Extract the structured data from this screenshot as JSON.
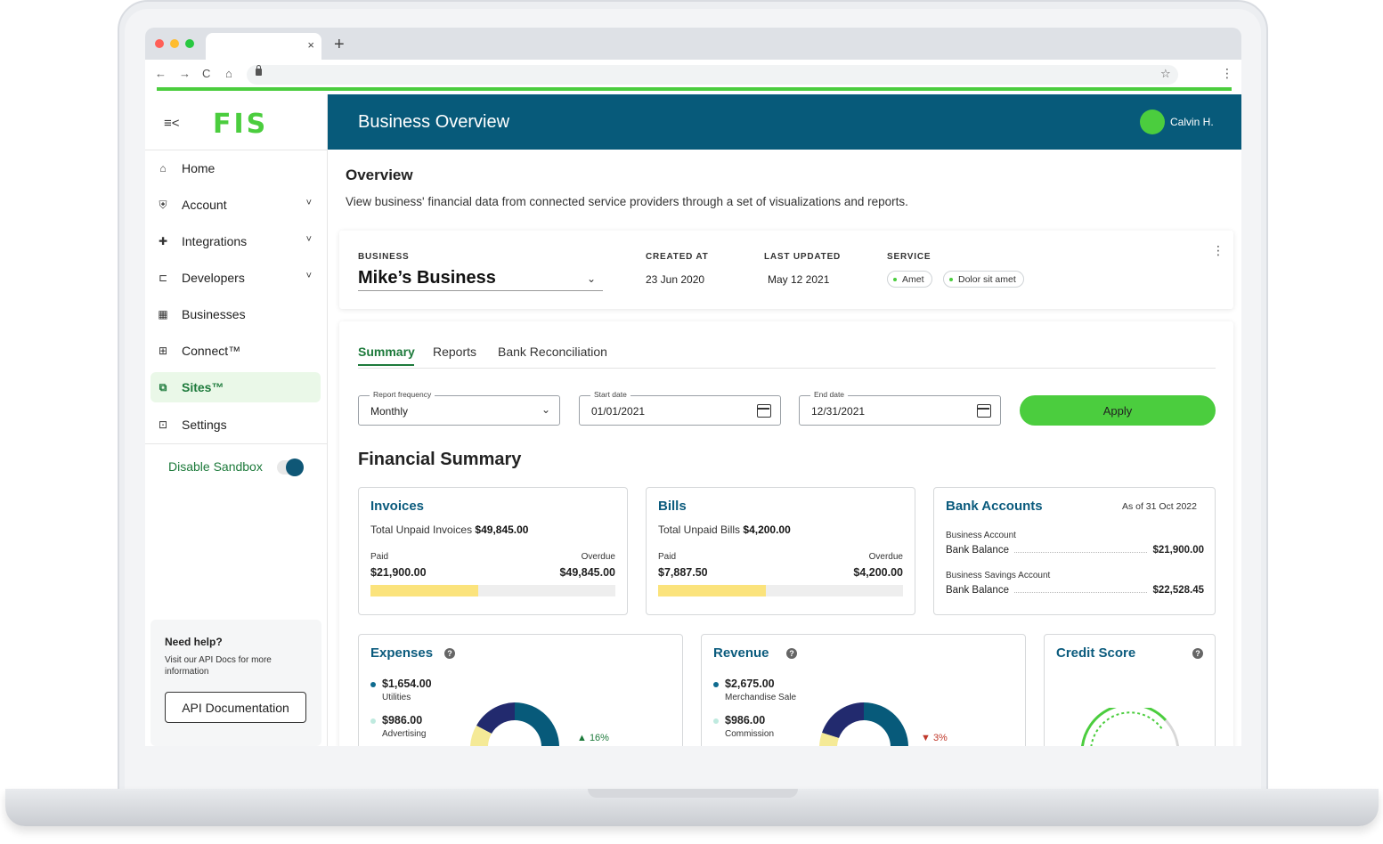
{
  "browser": {
    "tab_close": "×",
    "new_tab": "+",
    "back": "←",
    "forward": "→",
    "reload": "C",
    "home": "⌂",
    "bookmark": "☆",
    "menu": "⋮"
  },
  "sidebar": {
    "logo": "FIS",
    "menu_icon": "≡<",
    "items": [
      {
        "label": "Home",
        "icon": "home-icon",
        "glyph": "⌂",
        "expandable": false,
        "active": false
      },
      {
        "label": "Account",
        "icon": "shield-icon",
        "glyph": "⛨",
        "expandable": true,
        "active": false
      },
      {
        "label": "Integrations",
        "icon": "puzzle-icon",
        "glyph": "✚",
        "expandable": true,
        "active": false
      },
      {
        "label": "Developers",
        "icon": "code-icon",
        "glyph": "⊏",
        "expandable": true,
        "active": false
      },
      {
        "label": "Businesses",
        "icon": "building-icon",
        "glyph": "▦",
        "expandable": false,
        "active": false
      },
      {
        "label": "Connect™",
        "icon": "grid-icon",
        "glyph": "⊞",
        "expandable": false,
        "active": false
      },
      {
        "label": "Sites™",
        "icon": "sites-icon",
        "glyph": "⧉",
        "expandable": false,
        "active": true
      },
      {
        "label": "Settings",
        "icon": "settings-icon",
        "glyph": "⊡",
        "expandable": false,
        "active": false
      }
    ],
    "sandbox_label": "Disable Sandbox",
    "help": {
      "title": "Need help?",
      "text": "Visit our API Docs for more information",
      "button": "API Documentation"
    }
  },
  "header": {
    "title": "Business Overview",
    "user_name": "Calvin H.",
    "colors": {
      "header_bg": "#075a7a",
      "accent": "#4bcd3e"
    }
  },
  "overview": {
    "title": "Overview",
    "description": "View business' financial data from connected service providers through a set of visualizations and reports."
  },
  "business": {
    "business_label": "BUSINESS",
    "business_name": "Mike’s Business",
    "created_label": "CREATED AT",
    "created_value": "23 Jun 2020",
    "updated_label": "LAST UPDATED",
    "updated_value": "May 12 2021",
    "service_label": "SERVICE",
    "services": [
      "Amet",
      "Dolor sit amet"
    ]
  },
  "tabs": [
    {
      "label": "Summary",
      "active": true
    },
    {
      "label": "Reports",
      "active": false
    },
    {
      "label": "Bank Reconciliation",
      "active": false
    }
  ],
  "filters": {
    "frequency_label": "Report frequency",
    "frequency_value": "Monthly",
    "start_label": "Start date",
    "start_value": "01/01/2021",
    "end_label": "End date",
    "end_value": "12/31/2021",
    "apply_label": "Apply"
  },
  "financial_summary": {
    "title": "Financial Summary",
    "invoices": {
      "title": "Invoices",
      "total_label": "Total Unpaid Invoices",
      "total_value": "$49,845.00",
      "paid_label": "Paid",
      "paid_value": "$21,900.00",
      "overdue_label": "Overdue",
      "overdue_value": "$49,845.00",
      "paid_fraction": 0.44
    },
    "bills": {
      "title": "Bills",
      "total_label": "Total Unpaid Bills",
      "total_value": "$4,200.00",
      "paid_label": "Paid",
      "paid_value": "$7,887.50",
      "overdue_label": "Overdue",
      "overdue_value": "$4,200.00",
      "paid_fraction": 0.44
    },
    "bank_accounts": {
      "title": "Bank Accounts",
      "as_of": "As of 31 Oct 2022",
      "accounts": [
        {
          "name": "Business Account",
          "label": "Bank Balance",
          "value": "$21,900.00"
        },
        {
          "name": "Business Savings Account",
          "label": "Bank Balance",
          "value": "$22,528.45"
        }
      ]
    },
    "expenses": {
      "title": "Expenses",
      "help": "?",
      "items": [
        {
          "amount": "$1,654.00",
          "label": "Utilities",
          "color": "#0f6b8f"
        },
        {
          "amount": "$986.00",
          "label": "Advertising",
          "color": "#bfeadf"
        }
      ],
      "trend": "▲ 16%",
      "trend_color": "#1d7a3b"
    },
    "revenue": {
      "title": "Revenue",
      "help": "?",
      "items": [
        {
          "amount": "$2,675.00",
          "label": "Merchandise Sale",
          "color": "#0f6b8f"
        },
        {
          "amount": "$986.00",
          "label": "Commission",
          "color": "#bfeadf"
        }
      ],
      "trend": "▼ 3%",
      "trend_color": "#c0392b"
    },
    "credit_score": {
      "title": "Credit Score",
      "help": "?"
    }
  }
}
